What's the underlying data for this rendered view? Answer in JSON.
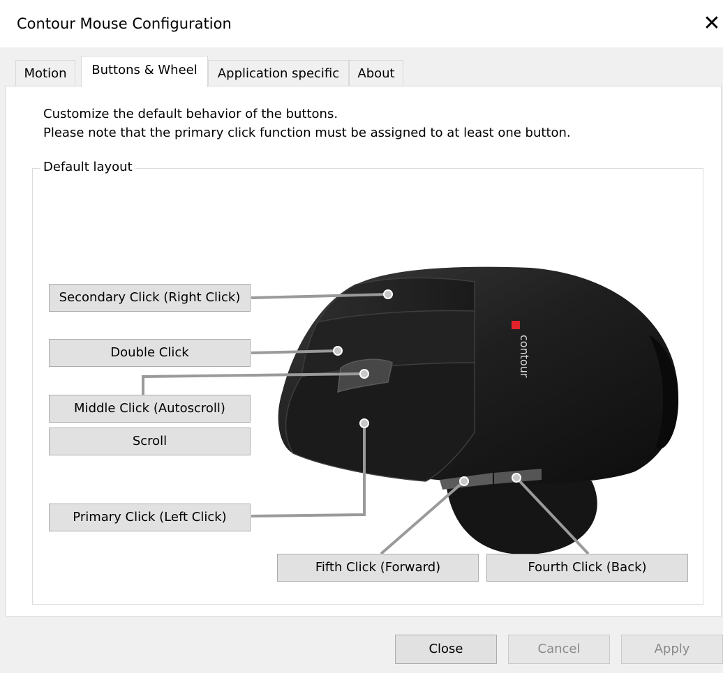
{
  "window": {
    "title": "Contour Mouse Configuration"
  },
  "tabs": [
    {
      "label": "Motion"
    },
    {
      "label": "Buttons & Wheel"
    },
    {
      "label": "Application specific"
    },
    {
      "label": "About"
    }
  ],
  "panel": {
    "line1": "Customize the default behavior of the buttons.",
    "line2": "Please note that the primary click function must be assigned to at least one button.",
    "group_label": "Default layout",
    "brand_text": "contour",
    "buttons": {
      "secondary": "Secondary Click (Right Click)",
      "double": "Double Click",
      "middle": "Middle Click (Autoscroll)",
      "scroll": "Scroll",
      "primary": "Primary Click (Left Click)",
      "fifth": "Fifth Click (Forward)",
      "fourth": "Fourth Click (Back)"
    }
  },
  "dialog_buttons": {
    "close": "Close",
    "cancel": "Cancel",
    "apply": "Apply"
  },
  "colors": {
    "brand_red": "#e2222a",
    "mouse_body": "#1e1e1e",
    "connector": "#9a9a9a"
  }
}
